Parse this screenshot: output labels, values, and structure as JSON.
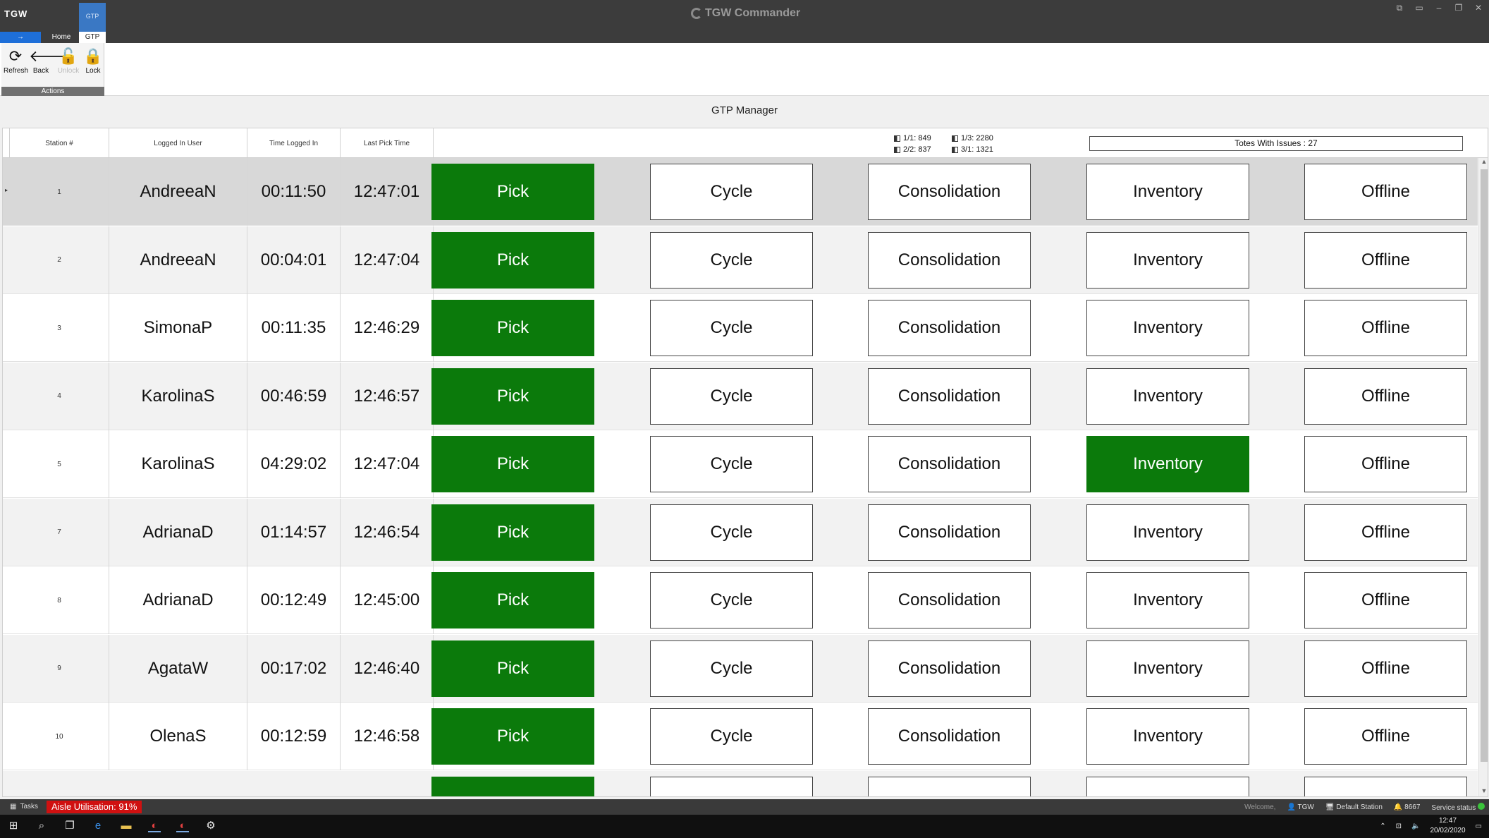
{
  "window": {
    "logo": "TGW",
    "title": "TGW Commander",
    "controls": [
      "⧉",
      "▭",
      "–",
      "❐",
      "✕"
    ]
  },
  "tabs": {
    "file": "→",
    "home": "Home",
    "gtp_top": "GTP",
    "gtp": "GTP"
  },
  "ribbon": {
    "refresh": "Refresh",
    "back": "Back",
    "unlock": "Unlock",
    "lock": "Lock",
    "group_caption": "Actions"
  },
  "panel": {
    "title": "GTP Manager"
  },
  "table": {
    "headers": {
      "station": "Station #",
      "user": "Logged In User",
      "time_logged_in": "Time Logged In",
      "last_pick": "Last Pick Time"
    },
    "stats": {
      "a": "1/1: 849",
      "b": "1/3: 2280",
      "c": "2/2: 837",
      "d": "3/1: 1321"
    },
    "totes": "Totes With Issues : 27",
    "button_labels": {
      "pick": "Pick",
      "cycle": "Cycle",
      "consolidation": "Consolidation",
      "inventory": "Inventory",
      "offline": "Offline"
    },
    "rows": [
      {
        "station": "1",
        "user": "AndreeaN",
        "time": "00:11:50",
        "last": "12:47:01",
        "active": "pick"
      },
      {
        "station": "2",
        "user": "AndreeaN",
        "time": "00:04:01",
        "last": "12:47:04",
        "active": "pick"
      },
      {
        "station": "3",
        "user": "SimonaP",
        "time": "00:11:35",
        "last": "12:46:29",
        "active": "pick"
      },
      {
        "station": "4",
        "user": "KarolinaS",
        "time": "00:46:59",
        "last": "12:46:57",
        "active": "pick"
      },
      {
        "station": "5",
        "user": "KarolinaS",
        "time": "04:29:02",
        "last": "12:47:04",
        "active": "pick+inventory"
      },
      {
        "station": "7",
        "user": "AdrianaD",
        "time": "01:14:57",
        "last": "12:46:54",
        "active": "pick"
      },
      {
        "station": "8",
        "user": "AdrianaD",
        "time": "00:12:49",
        "last": "12:45:00",
        "active": "pick"
      },
      {
        "station": "9",
        "user": "AgataW",
        "time": "00:17:02",
        "last": "12:46:40",
        "active": "pick"
      },
      {
        "station": "10",
        "user": "OlenaS",
        "time": "00:12:59",
        "last": "12:46:58",
        "active": "pick"
      }
    ]
  },
  "statusbar": {
    "tasks": "Tasks",
    "aisle": "Aisle Utilisation: 91%",
    "welcome": "Welcome,",
    "user": "TGW",
    "station": "Default Station",
    "alerts": "8667",
    "service": "Service status"
  },
  "taskbar": {
    "time": "12:47",
    "date": "20/02/2020"
  },
  "colors": {
    "active_green": "#0b7a0b",
    "alert_red": "#d01010",
    "titlebar": "#3c3c3c"
  }
}
